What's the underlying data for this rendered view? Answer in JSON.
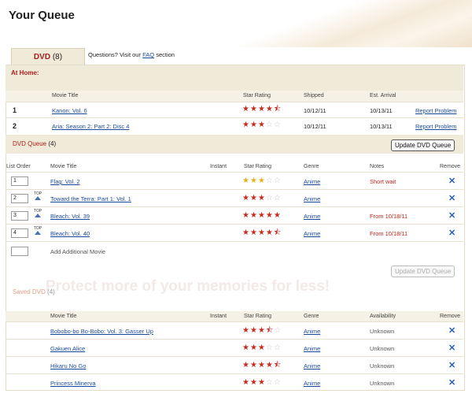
{
  "page_title": "Your Queue",
  "tab": {
    "label": "DVD",
    "count": "(8)"
  },
  "help": {
    "prefix": "Questions? Visit our",
    "link": "FAQ",
    "suffix": "section"
  },
  "at_home": {
    "title": "At Home:",
    "cols": {
      "title": "Movie Title",
      "rating": "Star Rating",
      "shipped": "Shipped",
      "arrival": "Est. Arrival"
    },
    "rows": [
      {
        "n": "1",
        "title": "Kanon: Vol. 6",
        "stars": "4.5",
        "shipped": "10/12/11",
        "arrival": "10/13/11",
        "action": "Report Problem"
      },
      {
        "n": "2",
        "title": "Aria: Season 2: Part 2: Disc 4",
        "stars": "3",
        "shipped": "10/12/11",
        "arrival": "10/13/11",
        "action": "Report Problem"
      }
    ]
  },
  "dvd_queue": {
    "title": "DVD Queue",
    "count": "(4)",
    "update": "Update DVD Queue",
    "cols": {
      "order": "List Order",
      "title": "Movie Title",
      "instant": "Instant",
      "rating": "Star Rating",
      "genre": "Genre",
      "notes": "Notes",
      "remove": "Remove"
    },
    "top_label": "TOP",
    "rows": [
      {
        "order": "1",
        "title": "Flag: Vol. 2",
        "stars": "3",
        "genre": "Anime",
        "notes": "Short wait"
      },
      {
        "order": "2",
        "title": "Toward the Terra: Part 1: Vol. 1",
        "stars": "3",
        "genre": "Anime",
        "notes": ""
      },
      {
        "order": "3",
        "title": "Bleach: Vol. 39",
        "stars": "5",
        "genre": "Anime",
        "notes": "From 10/18/11"
      },
      {
        "order": "4",
        "title": "Bleach: Vol. 40",
        "stars": "4.5",
        "genre": "Anime",
        "notes": "From 10/18/11"
      }
    ],
    "add_label": "Add Additional Movie"
  },
  "watermark": "Protect more of your memories for less!",
  "saved": {
    "title": "Saved DVD",
    "count": "(4)",
    "cols": {
      "title": "Movie Title",
      "instant": "Instant",
      "rating": "Star Rating",
      "genre": "Genre",
      "availability": "Availability",
      "remove": "Remove"
    },
    "rows": [
      {
        "title": "Bobobo-bo Bo-Bobo: Vol. 3: Gasser Up",
        "stars": "3.5",
        "genre": "Anime",
        "availability": "Unknown"
      },
      {
        "title": "Gakuen Alice",
        "stars": "3",
        "genre": "Anime",
        "availability": "Unknown"
      },
      {
        "title": "Hikaru No Go",
        "stars": "4.5",
        "genre": "Anime",
        "availability": "Unknown"
      },
      {
        "title": "Princess Minerva",
        "stars": "3",
        "genre": "Anime",
        "availability": "Unknown"
      }
    ]
  },
  "colors": {
    "accent": "#b01c1c",
    "link": "#1a4a9c",
    "band": "#f0ead8",
    "star": "#c9291e"
  }
}
